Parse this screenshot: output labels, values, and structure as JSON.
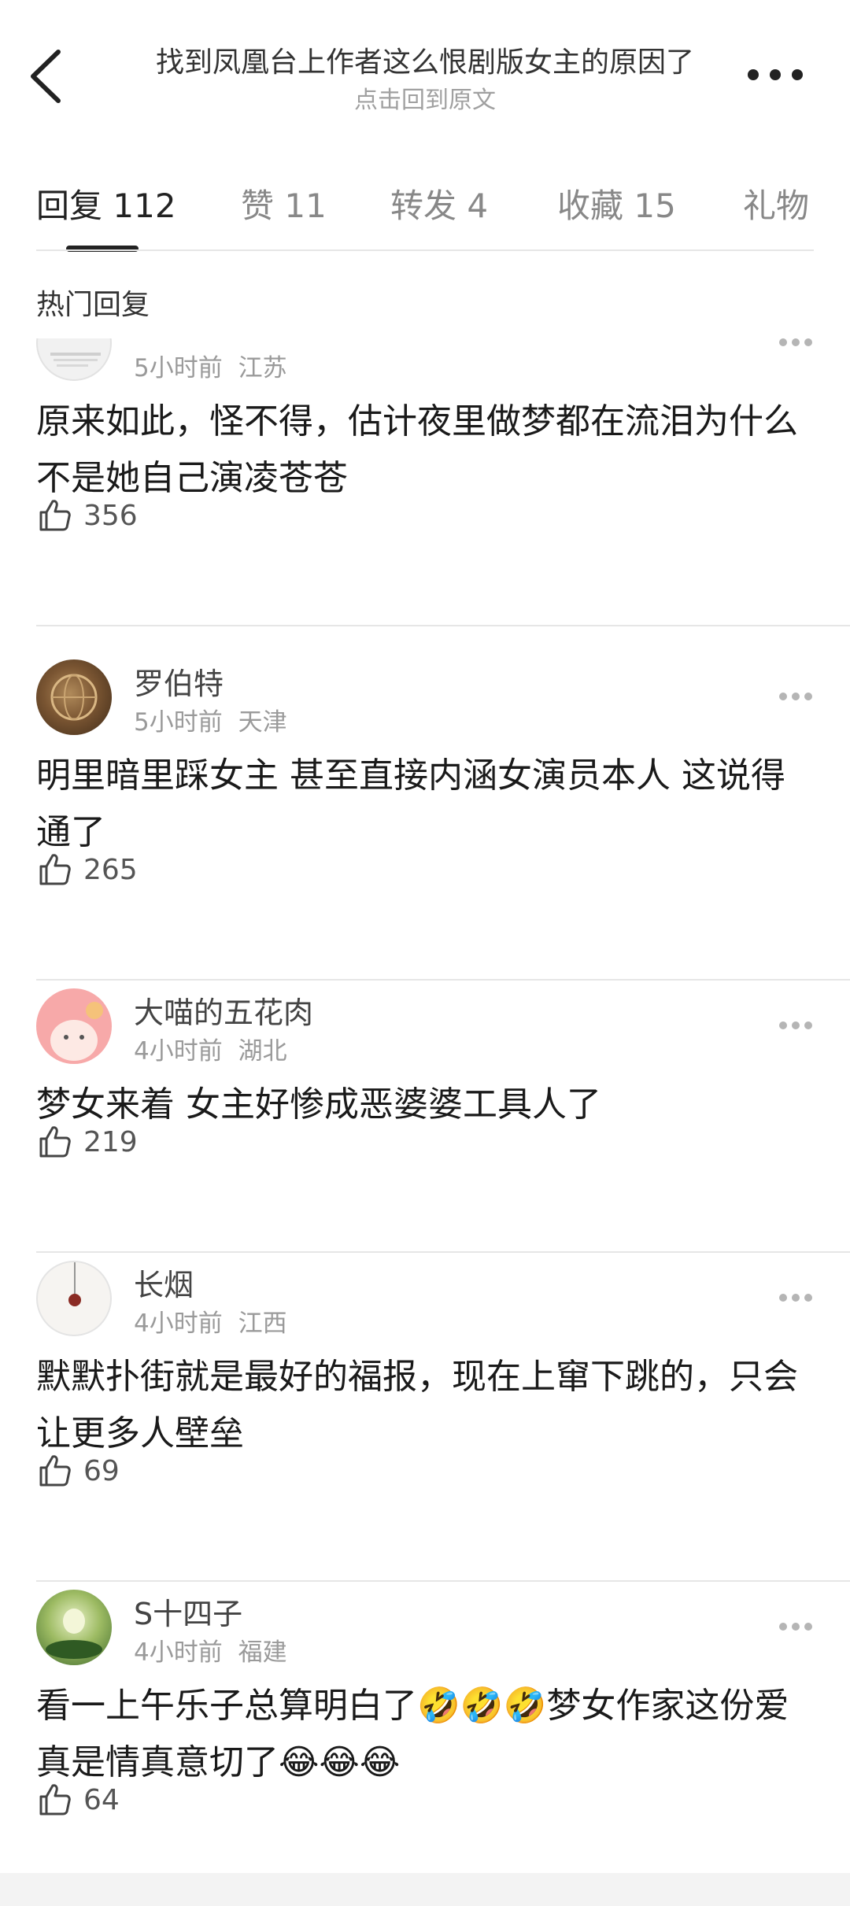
{
  "header": {
    "title": "找到凤凰台上作者这么恨剧版女主的原因了",
    "subtitle": "点击回到原文"
  },
  "tabs": [
    {
      "label": "回复",
      "count": "112"
    },
    {
      "label": "赞",
      "count": "11"
    },
    {
      "label": "转发",
      "count": "4"
    },
    {
      "label": "收藏",
      "count": "15"
    },
    {
      "label": "礼物",
      "count": ""
    }
  ],
  "section_label": "热门回复",
  "comments": [
    {
      "name": "",
      "time": "5小时前",
      "location": "江苏",
      "text": "原来如此，怪不得，估计夜里做梦都在流泪为什么不是她自己演凌苍苍",
      "likes": "356"
    },
    {
      "name": "罗伯特",
      "time": "5小时前",
      "location": "天津",
      "text": "明里暗里踩女主 甚至直接内涵女演员本人 这说得通了",
      "likes": "265"
    },
    {
      "name": "大喵的五花肉",
      "time": "4小时前",
      "location": "湖北",
      "text": "梦女来着 女主好惨成恶婆婆工具人了",
      "likes": "219"
    },
    {
      "name": "长烟",
      "time": "4小时前",
      "location": "江西",
      "text": "默默扑街就是最好的福报，现在上窜下跳的，只会让更多人壁垒",
      "likes": "69"
    },
    {
      "name": "S十四子",
      "time": "4小时前",
      "location": "福建",
      "text_part1": "看一上午乐子总算明白了",
      "emoji1": "🤣🤣🤣",
      "text_part2": "梦女作家这份爱真是情真意切了",
      "emoji2": "😂😂😂",
      "likes": "64"
    }
  ],
  "colors": {
    "background": "#ffffff",
    "text_primary": "#1a1a1a",
    "text_secondary": "#9a9a9a",
    "divider": "#e6e6e6"
  },
  "icons": {
    "back": "chevron-left-icon",
    "more": "more-horizontal-icon",
    "like": "thumbs-up-icon"
  }
}
